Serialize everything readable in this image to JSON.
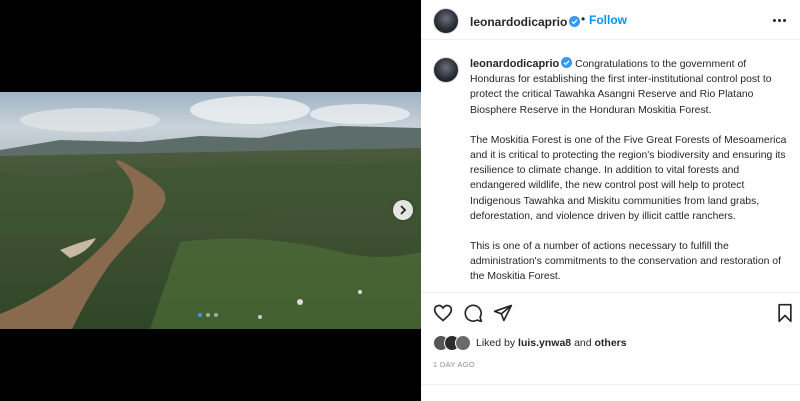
{
  "header": {
    "username": "leonardodicaprio",
    "separator": "•",
    "follow_label": "Follow",
    "more_icon": "more-horizontal-icon"
  },
  "media": {
    "next_icon": "chevron-right-icon",
    "carousel_count": 3,
    "carousel_active": 1
  },
  "caption": {
    "username": "leonardodicaprio",
    "paragraph1": "Congratulations to the government of Honduras for establishing the first inter-institutional control post to protect the critical Tawahka Asangni Reserve and Rio Platano Biosphere Reserve in the Honduran Moskitia Forest.",
    "paragraph2": "The Moskitia Forest is one of the Five Great Forests of Mesoamerica and it is critical to protecting the region's biodiversity and ensuring its resilience to climate change. In addition to vital forests and endangered wildlife, the new control post will help to protect Indigenous Tawahka and Miskitu communities from land grabs, deforestation, and violence driven by illicit cattle ranchers.",
    "paragraph3": "This is one of a number of actions necessary to fulfill the administration's commitments to the conservation and restoration of the Moskitia Forest."
  },
  "actions": {
    "icons": [
      "heart-icon",
      "comment-icon",
      "share-icon",
      "bookmark-icon"
    ]
  },
  "likes": {
    "prefix": "Liked by",
    "user": "luis.ynwa8",
    "and": "and",
    "others": "others"
  },
  "date": "1 DAY AGO",
  "colors": {
    "accent": "#0095f6",
    "verified": "#3897f0",
    "text": "#262626",
    "muted": "#8e8e8e"
  }
}
